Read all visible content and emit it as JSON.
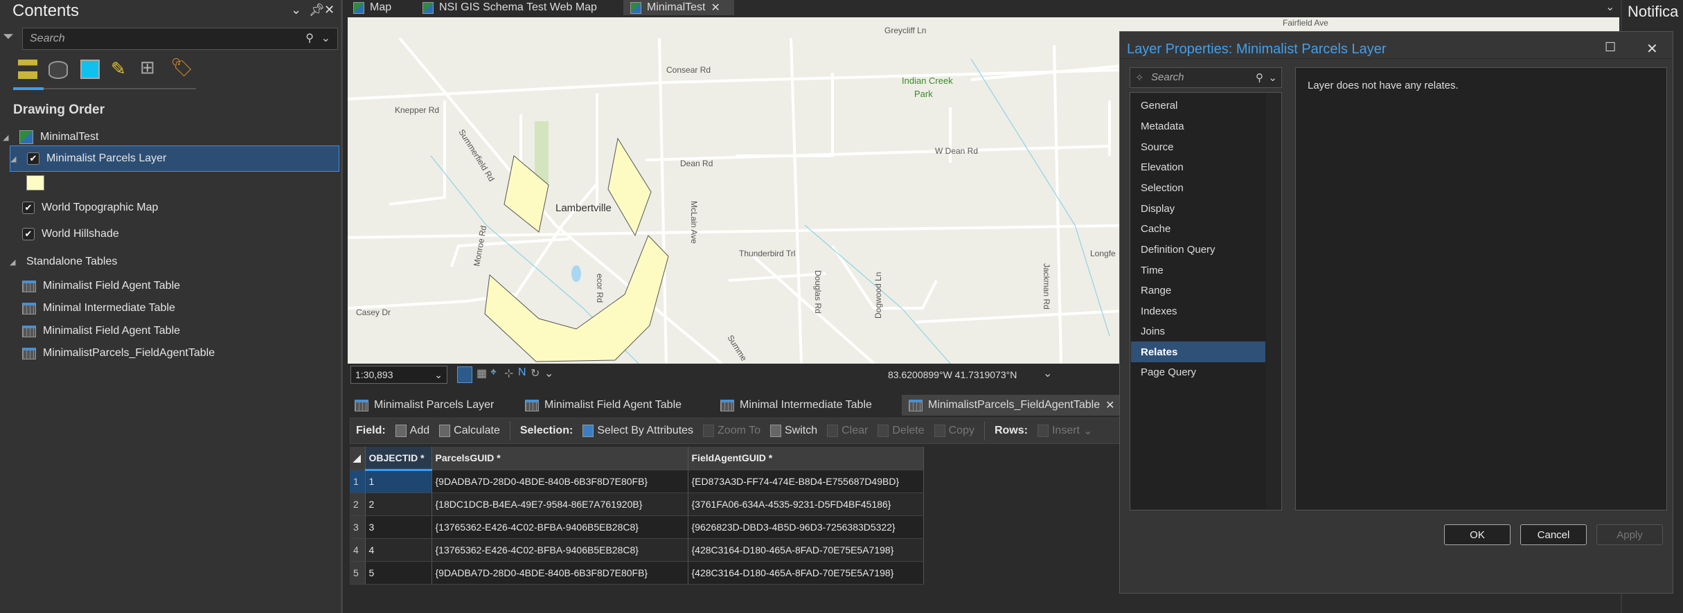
{
  "contents": {
    "title": "Contents",
    "search_placeholder": "Search",
    "section": "Drawing Order",
    "map": "MinimalTest",
    "layers": [
      {
        "label": "Minimalist Parcels Layer",
        "checked": true,
        "selected": true
      },
      {
        "label": "World Topographic Map",
        "checked": true
      },
      {
        "label": "World Hillshade",
        "checked": true
      }
    ],
    "swatch_color": "#fdfcc4",
    "standalone_header": "Standalone Tables",
    "tables": [
      "Minimalist Field Agent Table",
      "Minimal Intermediate Table",
      "Minimalist Field Agent Table",
      "MinimalistParcels_FieldAgentTable"
    ]
  },
  "view_tabs": [
    {
      "label": "Map"
    },
    {
      "label": "NSI GIS Schema Test Web Map"
    },
    {
      "label": "MinimalTest",
      "active": true
    }
  ],
  "map": {
    "labels": {
      "greycliff": "Greycliff Ln",
      "consear": "Consear Rd",
      "park": "Indian Creek",
      "park2": "Park",
      "knepper": "Knepper Rd",
      "summerfield": "Summerfield Rd",
      "dean": "Dean Rd",
      "wdean": "W Dean Rd",
      "lambertville": "Lambertville",
      "mclain": "McLain Ave",
      "thunderbird": "Thunderbird Trl",
      "monroe": "Monroe Rd",
      "casey": "Casey Dr",
      "douglas": "Douglas Rd",
      "dogwood": "Dogwood Ln",
      "jackman": "Jackman Rd",
      "longfe": "Longfe",
      "fairfield": "Fairfield Ave",
      "ecor": "ecor Rd",
      "summe": "Summe"
    },
    "scale": "1:30,893",
    "coordinates": "83.6200899°W 41.7319073°N"
  },
  "table_tabs": [
    "Minimalist Parcels Layer",
    "Minimalist Field Agent Table",
    "Minimal Intermediate Table",
    "MinimalistParcels_FieldAgentTable"
  ],
  "toolbar": {
    "field": "Field:",
    "add": "Add",
    "calculate": "Calculate",
    "selection": "Selection:",
    "select_by_attr": "Select By Attributes",
    "zoom_to": "Zoom To",
    "switch": "Switch",
    "clear": "Clear",
    "delete": "Delete",
    "copy": "Copy",
    "rows": "Rows:",
    "insert": "Insert"
  },
  "grid": {
    "columns": [
      "OBJECTID *",
      "ParcelsGUID *",
      "FieldAgentGUID *"
    ],
    "rows": [
      [
        "1",
        "{9DADBA7D-28D0-4BDE-840B-6B3F8D7E80FB}",
        "{ED873A3D-FF74-474E-B8D4-E755687D49BD}"
      ],
      [
        "2",
        "{18DC1DCB-B4EA-49E7-9584-86E7A761920B}",
        "{3761FA06-634A-4535-9231-D5FD4BF45186}"
      ],
      [
        "3",
        "{13765362-E426-4C02-BFBA-9406B5EB28C8}",
        "{9626823D-DBD3-4B5D-96D3-7256383D5322}"
      ],
      [
        "4",
        "{13765362-E426-4C02-BFBA-9406B5EB28C8}",
        "{428C3164-D180-465A-8FAD-70E75E5A7198}"
      ],
      [
        "5",
        "{9DADBA7D-28D0-4BDE-840B-6B3F8D7E80FB}",
        "{428C3164-D180-465A-8FAD-70E75E5A7198}"
      ]
    ]
  },
  "dialog": {
    "title": "Layer Properties: Minimalist Parcels Layer",
    "search_placeholder": "Search",
    "nav": [
      "General",
      "Metadata",
      "Source",
      "Elevation",
      "Selection",
      "Display",
      "Cache",
      "Definition Query",
      "Time",
      "Range",
      "Indexes",
      "Joins",
      "Relates",
      "Page Query"
    ],
    "selected": "Relates",
    "message": "Layer does not have any relates.",
    "ok": "OK",
    "cancel": "Cancel",
    "apply": "Apply"
  },
  "notifications": {
    "title": "Notifica"
  }
}
